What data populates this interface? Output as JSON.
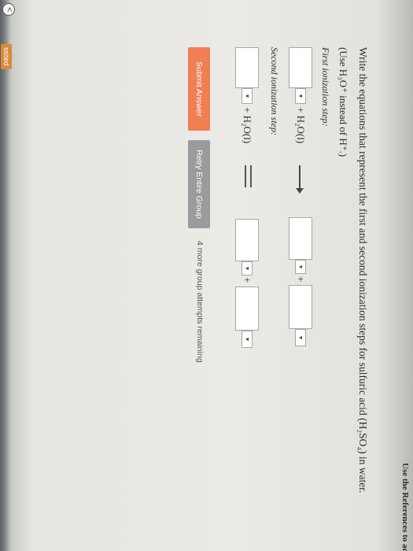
{
  "header": {
    "references_link": "Use the References to access"
  },
  "question": {
    "text": "Write the equations that represent the first and second ionization steps for sulfuric acid (H₂SO₄) in water.",
    "instruction": "(Use H₃O⁺ instead of H⁺.)"
  },
  "steps": [
    {
      "label": "First ionization step:",
      "water": "+ H₂O(l)",
      "plus": "+",
      "arrow_icon": "right-arrow-icon"
    },
    {
      "label": "Second ionization step:",
      "water": "+ H₂O(l)",
      "plus": "+",
      "arrow_icon": "equilibrium-arrow-icon"
    }
  ],
  "dropdown": {
    "glyph": "▼"
  },
  "buttons": {
    "submit": "Submit Answer",
    "retry": "Retry Entire Group"
  },
  "attempts": "4 more group attempts remaining",
  "nav": {
    "back_glyph": "<",
    "previous_label": "ssited"
  },
  "colors": {
    "submit": "#f07f54",
    "retry": "#9a9b9d"
  }
}
